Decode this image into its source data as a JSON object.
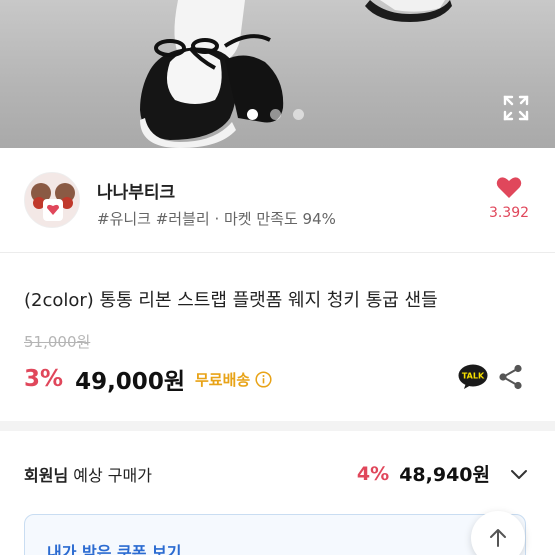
{
  "gallery": {
    "image_alt": "product photo",
    "dots": [
      true,
      false,
      false
    ],
    "expand_icon": "expand-icon"
  },
  "shop": {
    "name": "나나부티크",
    "tags": "#유니크 #러블리 · 마켓 만족도 94%",
    "like_count": "3.392",
    "like_color": "#e0475b"
  },
  "product": {
    "title": "(2color) 통통 리본 스트랩 플랫폼 웨지 청키 통굽 샌들",
    "original_price": "51,000원",
    "discount": "3%",
    "price": "49,000원",
    "shipping": "무료배송",
    "talk_label": "TALK"
  },
  "member": {
    "label_bold": "회원님",
    "label_rest": " 예상 구매가",
    "discount": "4%",
    "price": "48,940원"
  },
  "coupon": {
    "label": "내가 받은 쿠폰 보기"
  },
  "colors": {
    "accent_red": "#e0475b",
    "shipping_orange": "#e8a317",
    "coupon_blue": "#2b6bd1"
  }
}
